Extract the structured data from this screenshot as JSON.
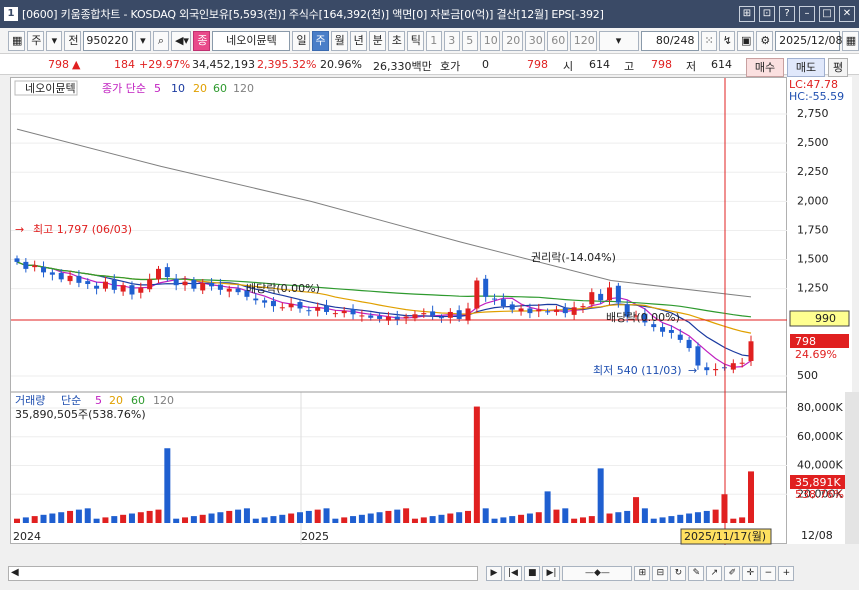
{
  "window": {
    "badge": "1",
    "title": "[0600] 키움종합차트 - KOSDAQ 외국인보유[5,593(천)] 주식수[164,392(천)] 액면[0] 자본금[0(억)] 결산[12월] EPS[-392]"
  },
  "toolbar": {
    "market": "주",
    "whole": "전",
    "code": "950220",
    "stock_name": "네오이뮨텍",
    "stock_prefix": "종",
    "periods": [
      "일",
      "주",
      "월",
      "년",
      "분",
      "초",
      "틱"
    ],
    "selected_period": "주",
    "minutes": [
      "1",
      "3",
      "5",
      "10",
      "20",
      "30",
      "60",
      "120"
    ],
    "count": "80",
    "count_total": "/248",
    "date": "2025/12/08"
  },
  "quote": {
    "price": "798",
    "arrow": "▲",
    "change": "184",
    "change_pct": "+29.97%",
    "volume": "34,452,193",
    "volume_pct": "2,395.32%",
    "turnover": "20.96%",
    "amount": "26,330백만",
    "hoga_label": "호가",
    "hoga_value": "0",
    "hoga_price": "798",
    "open_label": "시",
    "open": "614",
    "high_label": "고",
    "high": "798",
    "low_label": "저",
    "low": "614",
    "buy": "매수",
    "sell": "매도",
    "eval": "평"
  },
  "price_panel": {
    "stock_tag": "네오이뮨텍",
    "legend_title": "종가 단순",
    "ma_legend": [
      "5",
      "10",
      "20",
      "60",
      "120"
    ],
    "lc": "LC:47.78",
    "hc": "HC:-55.59",
    "ticks": [
      "2,750",
      "2,500",
      "2,250",
      "2,000",
      "1,750",
      "1,500",
      "1,250",
      "990",
      "798",
      "500"
    ],
    "current_tag": "798",
    "current_pct": "24.69%",
    "line_tag": "990",
    "annotations": {
      "high": "최고 1,797 (06/03)",
      "low": "최저 540 (11/03)",
      "dividend1": "배당락(0.00%)",
      "rights": "권리락(-14.04%)",
      "dividend2": "배당락(0.00%)"
    }
  },
  "volume_panel": {
    "legend_title": "거래량",
    "legend_ma": "단순",
    "ma_legend": [
      "5",
      "20",
      "60",
      "120"
    ],
    "volume_value": "35,890,505주(538.76%)",
    "ticks": [
      "80,000K",
      "60,000K",
      "40,000K",
      "20,000K"
    ],
    "current_tag": "35,891K",
    "current_pct": "538.76%"
  },
  "x_axis": {
    "labels": [
      "2024",
      "2025"
    ],
    "cursor_date": "2025/11/17(월)",
    "end_label": "12/08"
  },
  "colors": {
    "up": "#e02020",
    "down": "#1f5fd0",
    "ma5": "#c020c0",
    "ma10": "#1a3aa0",
    "ma20": "#e0a000",
    "ma60": "#2e9a2e",
    "ma120": "#808080",
    "title_bg": "#3a4a66"
  }
}
